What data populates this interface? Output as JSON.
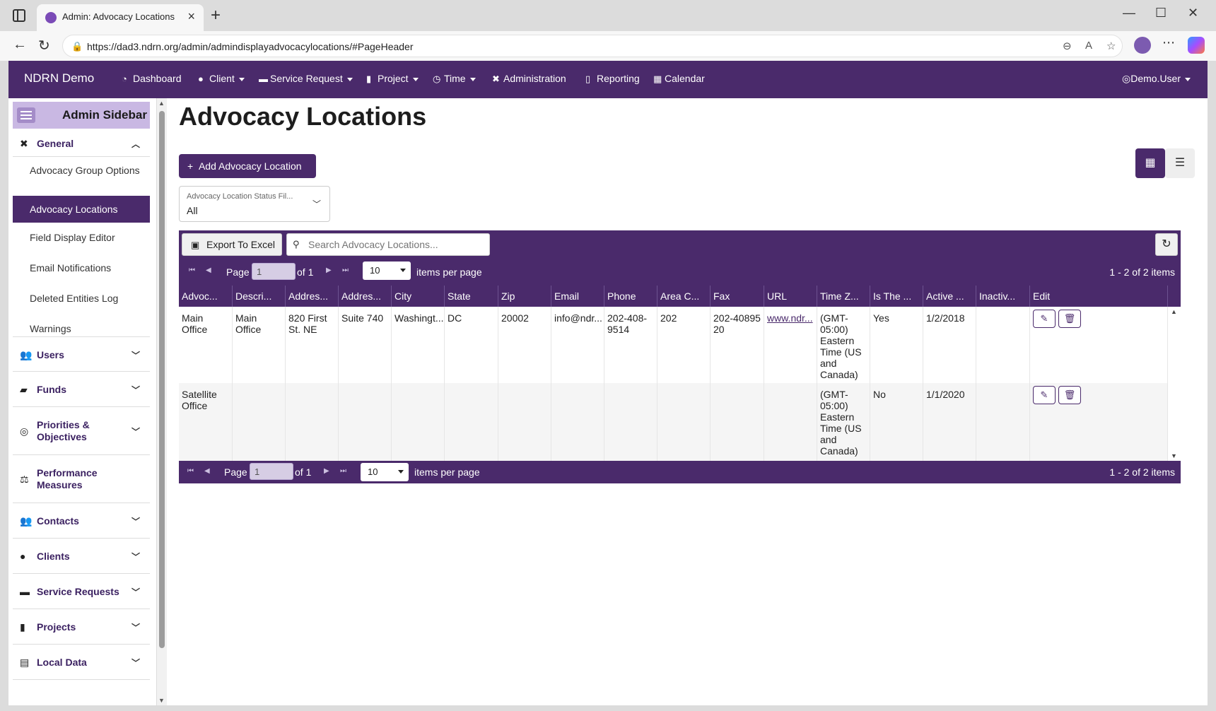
{
  "browser": {
    "tab_title": "Admin: Advocacy Locations",
    "url": "https://dad3.ndrn.org/admin/admindisplayadvocacylocations/#PageHeader"
  },
  "topnav": {
    "brand": "NDRN Demo",
    "items": [
      {
        "label": "Dashboard",
        "icon": "dashboard-icon",
        "dropdown": false
      },
      {
        "label": "Client",
        "icon": "user-icon",
        "dropdown": true
      },
      {
        "label": "Service Request",
        "icon": "briefcase-icon",
        "dropdown": true
      },
      {
        "label": "Project",
        "icon": "clipboard-icon",
        "dropdown": true
      },
      {
        "label": "Time",
        "icon": "clock-icon",
        "dropdown": true
      },
      {
        "label": "Administration",
        "icon": "tools-icon",
        "dropdown": false
      },
      {
        "label": "Reporting",
        "icon": "file-icon",
        "dropdown": false
      },
      {
        "label": "Calendar",
        "icon": "calendar-icon",
        "dropdown": false
      }
    ],
    "user": "Demo.User"
  },
  "sidebar": {
    "title": "Admin Sidebar",
    "general": "General",
    "general_items": [
      "Advocacy Group Options",
      "Advocacy Locations",
      "Field Display Editor",
      "Email Notifications",
      "Deleted Entities Log",
      "Warnings"
    ],
    "active_item": "Advocacy Locations",
    "sections": [
      "Users",
      "Funds",
      "Priorities & Objectives",
      "Performance Measures",
      "Contacts",
      "Clients",
      "Service Requests",
      "Projects",
      "Local Data"
    ]
  },
  "main": {
    "title": "Advocacy Locations",
    "add_button": "Add Advocacy Location",
    "filter": {
      "label": "Advocacy Location Status Fil...",
      "value": "All"
    }
  },
  "grid": {
    "export_button": "Export To Excel",
    "search_placeholder": "Search Advocacy Locations...",
    "pager": {
      "page_label": "Page",
      "page_value": "1",
      "of_label": "of 1",
      "per_page_value": "10",
      "per_page_label": "items per page",
      "info": "1 - 2 of 2 items"
    },
    "columns": [
      "Advoc...",
      "Descri...",
      "Addres...",
      "Addres...",
      "City",
      "State",
      "Zip",
      "Email",
      "Phone",
      "Area C...",
      "Fax",
      "URL",
      "Time Z...",
      "Is The ...",
      "Active ...",
      "Inactiv...",
      "Edit"
    ],
    "rows": [
      [
        "Main Office",
        "Main Office",
        "820 First St. NE",
        "Suite 740",
        "Washingt...",
        "DC",
        "20002",
        "info@ndr...",
        "202-408-9514",
        "202",
        "202-4089520",
        "www.ndr...",
        "(GMT-05:00) Eastern Time (US and Canada)",
        "Yes",
        "1/2/2018",
        "",
        ""
      ],
      [
        "Satellite Office",
        "",
        "",
        "",
        "",
        "",
        "",
        "",
        "",
        "",
        "",
        "",
        "(GMT-05:00) Eastern Time (US and Canada)",
        "No",
        "1/1/2020",
        "",
        ""
      ]
    ]
  }
}
